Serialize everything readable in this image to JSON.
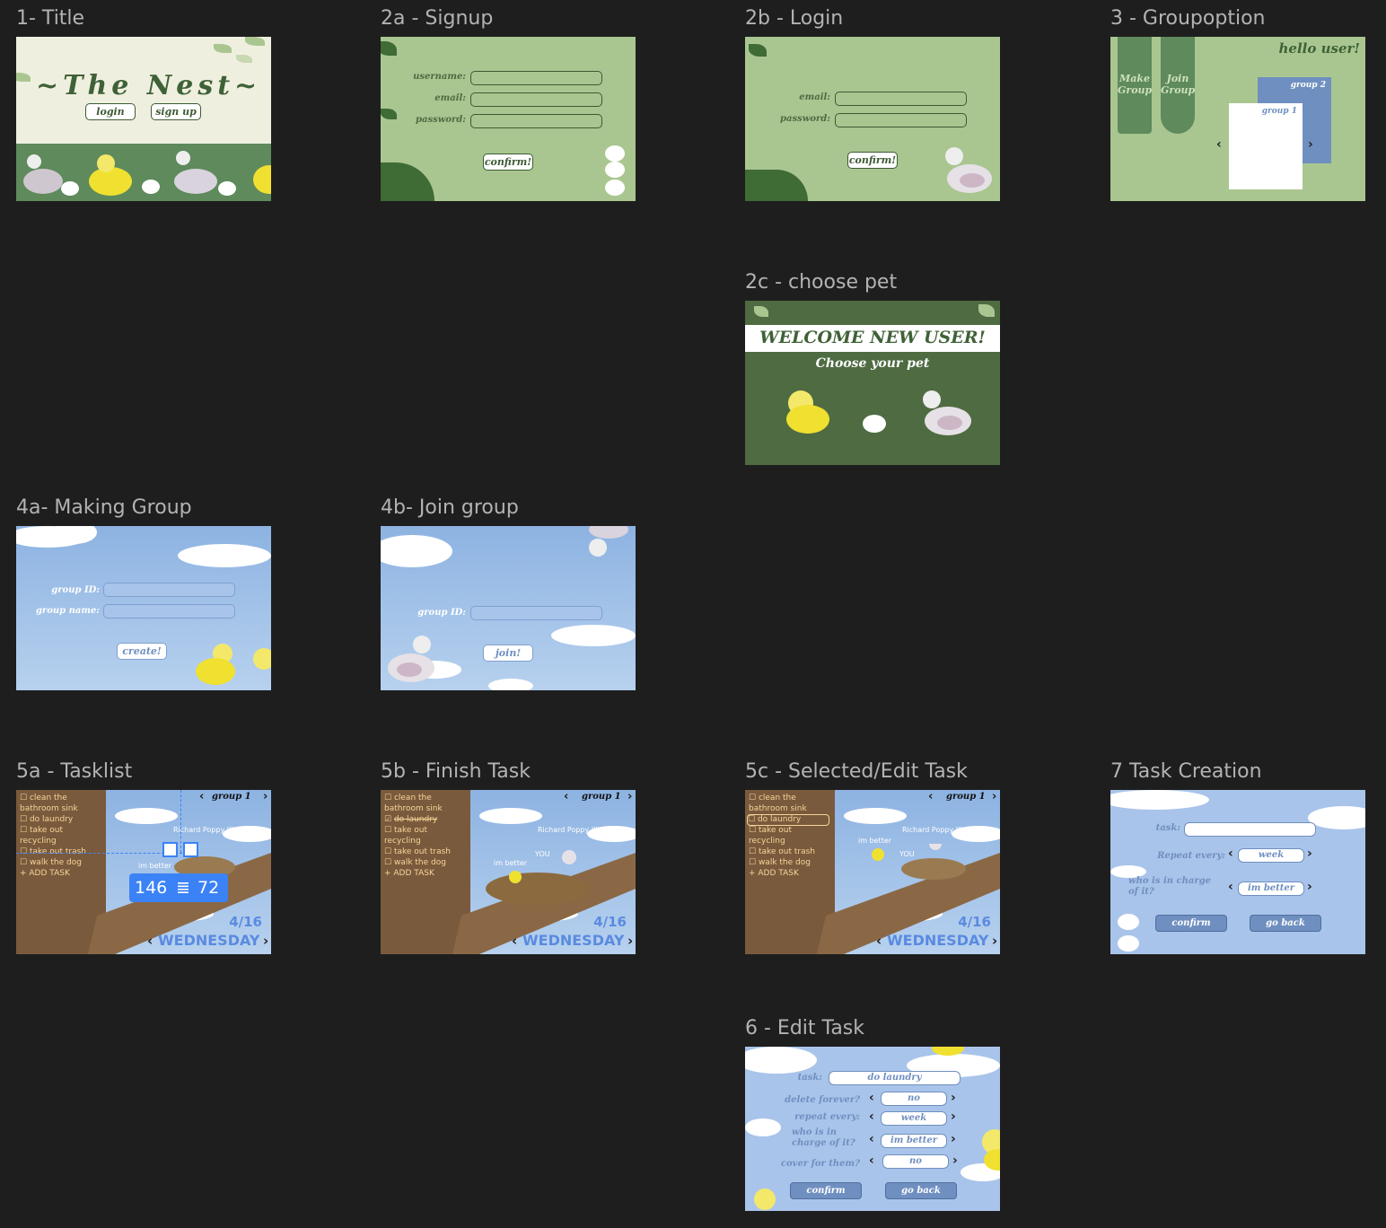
{
  "frames": {
    "title": {
      "label": "1- Title",
      "heading": "~The Nest~",
      "login": "login",
      "signup": "sign up"
    },
    "signup": {
      "label": "2a - Signup",
      "username": "username:",
      "email": "email:",
      "password": "password:",
      "confirm": "confirm!"
    },
    "login": {
      "label": "2b - Login",
      "email": "email:",
      "password": "password:",
      "confirm": "confirm!"
    },
    "groupoption": {
      "label": "3 - Groupoption",
      "hello": "hello user!",
      "make": "Make Group",
      "join": "Join Group",
      "group2": "group 2",
      "group1": "group 1"
    },
    "choosepet": {
      "label": "2c - choose pet",
      "welcome": "WELCOME NEW USER!",
      "choose": "Choose your pet"
    },
    "making": {
      "label": "4a- Making Group",
      "gid": "group ID:",
      "gname": "group name:",
      "create": "create!"
    },
    "joingroup": {
      "label": "4b- Join group",
      "gid": "group ID:",
      "join": "join!"
    },
    "tasklist": {
      "label": "5a - Tasklist",
      "badge_left": "146",
      "badge_right": "72"
    },
    "finish": {
      "label": "5b - Finish Task"
    },
    "selected": {
      "label": "5c - Selected/Edit Task"
    },
    "creation": {
      "label": "7 Task Creation",
      "task": "task:",
      "repeat": "Repeat every:",
      "repeat_val": "week",
      "who": "who is in charge of it?",
      "who_val": "im better",
      "confirm": "confirm",
      "goback": "go back"
    },
    "edit": {
      "label": "6 - Edit Task",
      "task": "task:",
      "task_val": "do laundry",
      "delete": "delete forever?",
      "delete_val": "no",
      "repeat": "repeat every:",
      "repeat_val": "week",
      "who": "who is in charge of it?",
      "who_val": "im better",
      "cover": "cover for them?",
      "cover_val": "no",
      "confirm": "confirm",
      "goback": "go back"
    }
  },
  "tasks": {
    "items": [
      "clean the",
      "bathroom sink",
      "do laundry",
      "take out",
      "recycling",
      "take out trash",
      "walk the dog",
      "+ ADD TASK"
    ],
    "group": "group 1",
    "owner": "Richard Poppy III",
    "you": "YOU",
    "other": "im better",
    "date": "4/16",
    "day": "WEDNESDAY"
  },
  "colors": {
    "green": "#a9c690",
    "darkgreen": "#5a7a4d",
    "sky": "#8db3e2",
    "blue": "#6f8fc0"
  }
}
